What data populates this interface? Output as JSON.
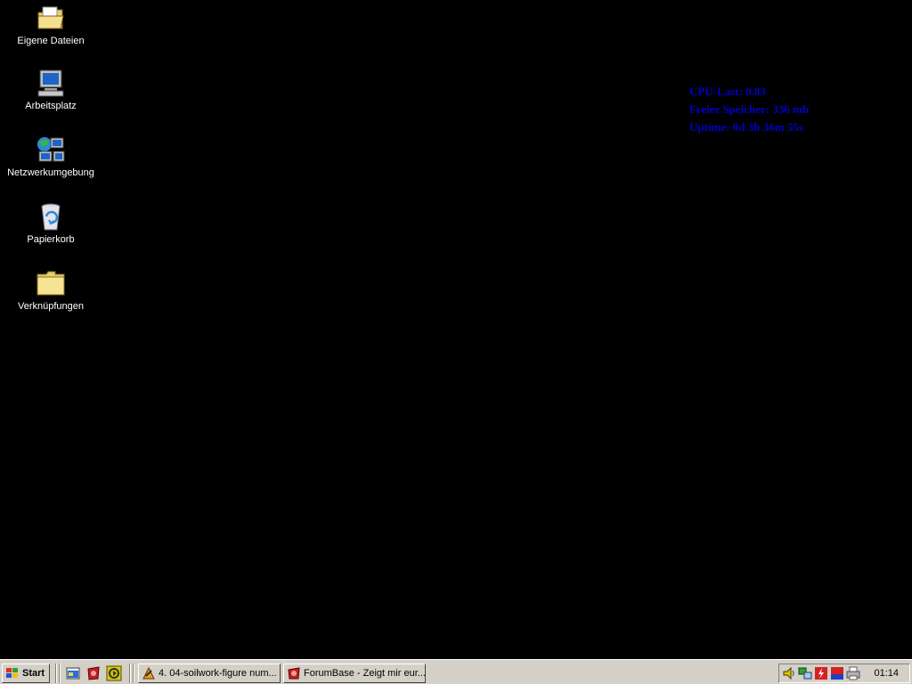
{
  "desktop": {
    "icons": [
      {
        "label": "Eigene Dateien",
        "icon": "my-documents-folder-icon"
      },
      {
        "label": "Arbeitsplatz",
        "icon": "my-computer-icon"
      },
      {
        "label": "Netzwerkumgebung",
        "icon": "network-places-icon"
      },
      {
        "label": "Papierkorb",
        "icon": "recycle-bin-icon"
      },
      {
        "label": "Verknüpfungen",
        "icon": "folder-icon"
      }
    ],
    "stats": {
      "cpu": "CPU-Last: 0.83",
      "memory": "Freier Speicher: 336 mb",
      "uptime": "Uptime: 0d 3h 36m 55s",
      "color": "#0000c8"
    }
  },
  "taskbar": {
    "start_label": "Start",
    "quicklaunch": [
      "show-desktop-icon",
      "app-icon",
      "media-player-icon"
    ],
    "tasks": [
      {
        "label": "4. 04-soilwork-figure num...",
        "icon": "winamp-icon"
      },
      {
        "label": "ForumBase - Zeigt mir eur...",
        "icon": "browser-icon"
      }
    ],
    "tray": {
      "icons": [
        "volume-icon",
        "network-icon",
        "antivirus-icon",
        "avg-icon",
        "printer-icon"
      ],
      "clock": "01:14"
    }
  },
  "colors": {
    "desktop_bg": "#000000",
    "taskbar_bg": "#d4d0c8",
    "icon_label": "#ffffff"
  }
}
